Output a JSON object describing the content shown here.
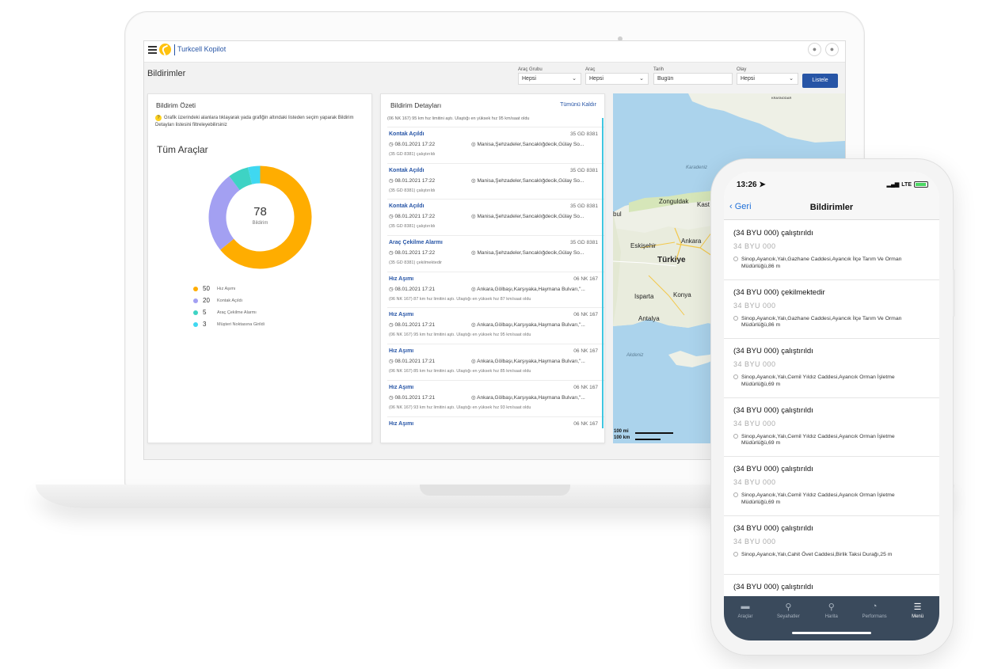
{
  "app": {
    "brand": "Turkcell Kopilot",
    "page_title": "Bildirimler"
  },
  "filters": [
    {
      "label": "Araç Grubu",
      "value": "Hepsi"
    },
    {
      "label": "Araç",
      "value": "Hepsi"
    },
    {
      "label": "Tarih",
      "value": "Bugün"
    },
    {
      "label": "Olay",
      "value": "Hepsi"
    }
  ],
  "list_button": "Listele",
  "summary": {
    "title": "Bildirim Özeti",
    "hint": "Grafik üzerindeki alanlara tıklayarak yada grafiğin altındaki listeden seçim yaparak Bildirim Detayları listesini filtreleyebilirsiniz",
    "heading": "Tüm Araçlar",
    "total": "78",
    "total_label": "Bildirim",
    "colors": [
      "#ffad00",
      "#a3a0f2",
      "#3ed3c4",
      "#3fd8f1"
    ]
  },
  "chart_data": {
    "type": "pie",
    "categories": [
      "Hız Aşımı",
      "Kontak Açıldı",
      "Araç Çekilme Alarmı",
      "Müşteri Noktasına Girildi"
    ],
    "values": [
      50,
      20,
      5,
      3
    ]
  },
  "details": {
    "title": "Bildirim Detayları",
    "clear_all": "Tümünü Kaldır",
    "first_line": "(06 NK 167) 95 km hız limitini aştı. Ulaştığı en yüksek hız 95 km/saat oldu",
    "items": [
      {
        "type": "Kontak Açıldı",
        "plate": "35 GD 8381",
        "time": "08.01.2021 17:22",
        "location": "Manisa,Şehzadeler,Sancaklığdecik,Gülay So...",
        "desc": "(35 GD 8381) çalıştırıldı"
      },
      {
        "type": "Kontak Açıldı",
        "plate": "35 GD 8381",
        "time": "08.01.2021 17:22",
        "location": "Manisa,Şehzadeler,Sancaklığdecik,Gülay So...",
        "desc": "(35 GD 8381) çalıştırıldı"
      },
      {
        "type": "Kontak Açıldı",
        "plate": "35 GD 8381",
        "time": "08.01.2021 17:22",
        "location": "Manisa,Şehzadeler,Sancaklığdecik,Gülay So...",
        "desc": "(35 GD 8381) çalıştırıldı"
      },
      {
        "type": "Araç Çekilme Alarmı",
        "plate": "35 GD 8381",
        "time": "08.01.2021 17:22",
        "location": "Manisa,Şehzadeler,Sancaklığdecik,Gülay So...",
        "desc": "(35 GD 8381) çekilmektedir"
      },
      {
        "type": "Hız Aşımı",
        "plate": "06 NK 167",
        "time": "08.01.2021 17:21",
        "location": "Ankara,Gölbaşı,Karşıyaka,Haymana Bulvarı,\"...",
        "desc": "(06 NK 167) 87 km hız limitini aştı. Ulaştığı en yüksek hız 87 km/saat oldu"
      },
      {
        "type": "Hız Aşımı",
        "plate": "06 NK 167",
        "time": "08.01.2021 17:21",
        "location": "Ankara,Gölbaşı,Karşıyaka,Haymana Bulvarı,\"...",
        "desc": "(06 NK 167) 95 km hız limitini aştı. Ulaştığı en yüksek hız 95 km/saat oldu"
      },
      {
        "type": "Hız Aşımı",
        "plate": "06 NK 167",
        "time": "08.01.2021 17:21",
        "location": "Ankara,Gölbaşı,Karşıyaka,Haymana Bulvarı,\"...",
        "desc": "(06 NK 167) 85 km hız limitini aştı. Ulaştığı en yüksek hız 85 km/saat oldu"
      },
      {
        "type": "Hız Aşımı",
        "plate": "06 NK 167",
        "time": "08.01.2021 17:21",
        "location": "Ankara,Gölbaşı,Karşıyaka,Haymana Bulvarı,\"...",
        "desc": "(06 NK 167) 93 km hız limitini aştı. Ulaştığı en yüksek hız 93 km/saat oldu"
      },
      {
        "type": "Hız Aşımı",
        "plate": "06 NK 167",
        "time": "",
        "location": "",
        "desc": ""
      }
    ]
  },
  "map": {
    "labels": [
      "Karadeniz",
      "Zonguldak",
      "Kast",
      "bul",
      "Eskişehir",
      "Ankara",
      "Türkiye",
      "Isparta",
      "Konya",
      "Antalya",
      "Akdeniz",
      "KRASNODAR"
    ],
    "scale": [
      "100 mi",
      "100 km"
    ]
  },
  "phone": {
    "time": "13:26",
    "network": "LTE",
    "back": "Geri",
    "title": "Bildirimler",
    "items": [
      {
        "title": "(34 BYU 000) çalıştırıldı",
        "plate": "34 BYU 000",
        "location": "Sinop,Ayancık,Yalı,Gazhane Caddesi,Ayancık İlçe Tarım Ve Orman Müdürlüğü,86 m"
      },
      {
        "title": "(34 BYU 000) çekilmektedir",
        "plate": "34 BYU 000",
        "location": "Sinop,Ayancık,Yalı,Gazhane Caddesi,Ayancık İlçe Tarım Ve Orman Müdürlüğü,86 m"
      },
      {
        "title": "(34 BYU 000) çalıştırıldı",
        "plate": "34 BYU 000",
        "location": "Sinop,Ayancık,Yalı,Cemil Yıldız Caddesi,Ayancık Orman İşletme Müdürlüğü,69 m"
      },
      {
        "title": "(34 BYU 000) çalıştırıldı",
        "plate": "34 BYU 000",
        "location": "Sinop,Ayancık,Yalı,Cemil Yıldız Caddesi,Ayancık Orman İşletme Müdürlüğü,69 m"
      },
      {
        "title": "(34 BYU 000) çalıştırıldı",
        "plate": "34 BYU 000",
        "location": "Sinop,Ayancık,Yalı,Cemil Yıldız Caddesi,Ayancık Orman İşletme Müdürlüğü,69 m"
      },
      {
        "title": "(34 BYU 000) çalıştırıldı",
        "plate": "34 BYU 000",
        "location": "Sinop,Ayancık,Yalı,Cahit Övet Caddesi,Birlik Taksi Durağı,25 m"
      },
      {
        "title": "(34 BYU 000) çalıştırıldı",
        "plate": "34 BYU 000",
        "location": ""
      }
    ],
    "tabs": [
      {
        "label": "Araçlar",
        "icon": "truck-icon"
      },
      {
        "label": "Seyahatler",
        "icon": "route-icon"
      },
      {
        "label": "Harita",
        "icon": "map-pin-icon"
      },
      {
        "label": "Performans",
        "icon": "gauge-icon"
      },
      {
        "label": "Menü",
        "icon": "menu-icon"
      }
    ],
    "active_tab": "Menü"
  }
}
